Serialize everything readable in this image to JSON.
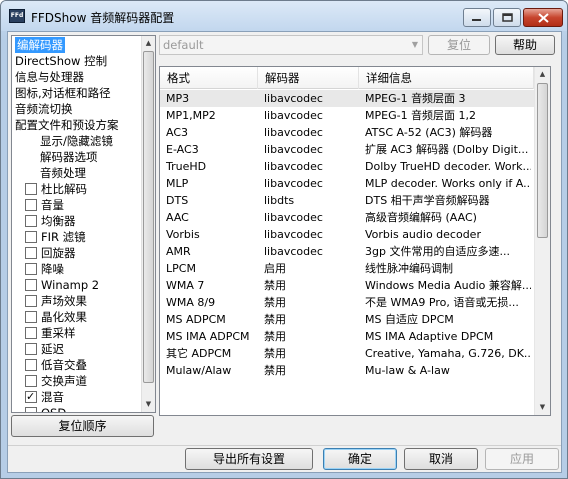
{
  "window": {
    "app_icon_text": "FFd",
    "title": "FFDShow 音频解码器配置"
  },
  "tree": {
    "items": [
      {
        "label": "编解码器",
        "type": "plain",
        "selected": true
      },
      {
        "label": "DirectShow 控制",
        "type": "plain"
      },
      {
        "label": "信息与处理器",
        "type": "plain"
      },
      {
        "label": "图标,对话框和路径",
        "type": "plain"
      },
      {
        "label": "音频流切换",
        "type": "plain"
      },
      {
        "label": "配置文件和预设方案",
        "type": "plain"
      },
      {
        "label": "显示/隐藏滤镜",
        "type": "sub"
      },
      {
        "label": "解码器选项",
        "type": "sub"
      },
      {
        "label": "音频处理",
        "type": "sub"
      },
      {
        "label": "杜比解码",
        "type": "check",
        "checked": false
      },
      {
        "label": "音量",
        "type": "check",
        "checked": false
      },
      {
        "label": "均衡器",
        "type": "check",
        "checked": false
      },
      {
        "label": "FIR 滤镜",
        "type": "check",
        "checked": false
      },
      {
        "label": "回旋器",
        "type": "check",
        "checked": false
      },
      {
        "label": "降噪",
        "type": "check",
        "checked": false
      },
      {
        "label": "Winamp 2",
        "type": "check",
        "checked": false
      },
      {
        "label": "声场效果",
        "type": "check",
        "checked": false
      },
      {
        "label": "晶化效果",
        "type": "check",
        "checked": false
      },
      {
        "label": "重采样",
        "type": "check",
        "checked": false
      },
      {
        "label": "延迟",
        "type": "check",
        "checked": false
      },
      {
        "label": "低音交叠",
        "type": "check",
        "checked": false
      },
      {
        "label": "交换声道",
        "type": "check",
        "checked": false
      },
      {
        "label": "混音",
        "type": "check",
        "checked": true
      },
      {
        "label": "OSD",
        "type": "check",
        "checked": false
      }
    ]
  },
  "buttons": {
    "reset_order": "复位顺序",
    "reset": "复位",
    "help": "帮助",
    "export_all": "导出所有设置",
    "ok": "确定",
    "cancel": "取消",
    "apply": "应用"
  },
  "preset_combo": {
    "value": "default"
  },
  "list": {
    "headers": [
      "格式",
      "解码器",
      "详细信息"
    ],
    "rows": [
      [
        "MP3",
        "libavcodec",
        "MPEG-1 音频层面 3"
      ],
      [
        "MP1,MP2",
        "libavcodec",
        "MPEG-1 音频层面 1,2"
      ],
      [
        "AC3",
        "libavcodec",
        "ATSC A-52 (AC3) 解码器"
      ],
      [
        "E-AC3",
        "libavcodec",
        "扩展 AC3 解码器 (Dolby Digit..."
      ],
      [
        "TrueHD",
        "libavcodec",
        "Dolby TrueHD decoder. Work..."
      ],
      [
        "MLP",
        "libavcodec",
        "MLP decoder. Works only if A..."
      ],
      [
        "DTS",
        "libdts",
        "DTS 相干声学音频解码器"
      ],
      [
        "AAC",
        "libavcodec",
        "高级音频编解码 (AAC)"
      ],
      [
        "Vorbis",
        "libavcodec",
        "Vorbis audio decoder"
      ],
      [
        "AMR",
        "libavcodec",
        "3gp 文件常用的自适应多速..."
      ],
      [
        "LPCM",
        "启用",
        "线性脉冲编码调制"
      ],
      [
        "WMA 7",
        "禁用",
        "Windows Media Audio 兼容解..."
      ],
      [
        "WMA 8/9",
        "禁用",
        "不是 WMA9 Pro, 语音或无损..."
      ],
      [
        "MS ADPCM",
        "禁用",
        "MS 自适应 DPCM"
      ],
      [
        "MS IMA ADPCM",
        "禁用",
        "MS IMA Adaptive DPCM"
      ],
      [
        "其它 ADPCM",
        "禁用",
        "Creative, Yamaha, G.726, DK..."
      ],
      [
        "Mulaw/Alaw",
        "禁用",
        "Mu-law & A-law"
      ]
    ],
    "highlighted_row": 0
  }
}
